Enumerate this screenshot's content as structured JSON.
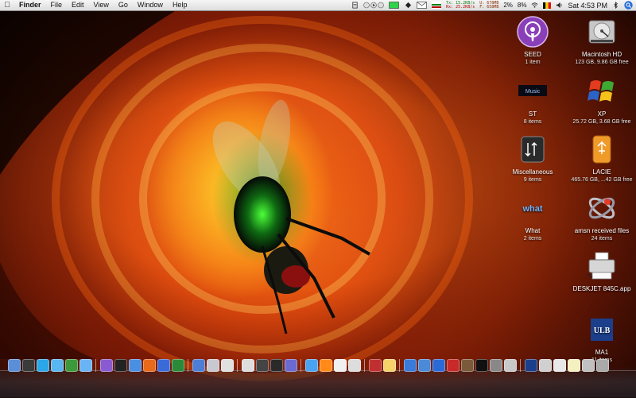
{
  "menubar": {
    "apple_icon": "apple-icon",
    "app_name": "Finder",
    "menus": [
      "File",
      "Edit",
      "View",
      "Go",
      "Window",
      "Help"
    ],
    "network": {
      "tx_label": "Tx:",
      "tx_rate": "15.2KB/s",
      "rx_label": "Rx:",
      "rx_rate": "25.2KB/s",
      "u_label": "U:",
      "u_value": "678MB",
      "f_label": "F:",
      "f_value": "658MB"
    },
    "cpu1": "2%",
    "cpu2": "8%",
    "clock": "Sat 4:53 PM",
    "status_icons": [
      "script-icon",
      "play-controls-icon",
      "battery-meter-icon",
      "growl-icon",
      "mail-icon",
      "bluetooth-icon",
      "wifi-icon",
      "flag-icon",
      "volume-icon",
      "spotlight-icon"
    ]
  },
  "desktop": {
    "icons": [
      {
        "label": "SEED",
        "sub": "1 item",
        "icon": "podcast-icon"
      },
      {
        "label": "Macintosh HD",
        "sub": "123 GB, 9.86 GB free",
        "icon": "hard-drive-icon"
      },
      {
        "label": "ST",
        "sub": "8 items",
        "icon": "music-folder-icon"
      },
      {
        "label": "XP",
        "sub": "25.72 GB, 3.68 GB free",
        "icon": "windows-xp-icon"
      },
      {
        "label": "Miscellaneous",
        "sub": "9 items",
        "icon": "misc-folder-icon"
      },
      {
        "label": "LACIE",
        "sub": "465.76 GB, ...42 GB free",
        "icon": "usb-drive-icon"
      },
      {
        "label": "What",
        "sub": "2 items",
        "icon": "what-folder-icon"
      },
      {
        "label": "amsn received files",
        "sub": "24 items",
        "icon": "amsn-icon"
      },
      {
        "label": "DESKJET 845C.app",
        "sub": "",
        "icon": "printer-icon"
      },
      {
        "label": "MA1",
        "sub": "11 items",
        "icon": "ulb-folder-icon"
      }
    ],
    "ulb_text": "ULB",
    "music_text": "Music",
    "what_text": "what"
  },
  "colors": {
    "menubar": "#e6e6e6",
    "podcast_purple": "#8a3fb8",
    "xp_red": "#e33b1f",
    "xp_green": "#3ea832",
    "xp_blue": "#2b63c7",
    "xp_yellow": "#f4c21a",
    "ulb_navy": "#1b3f8a",
    "lacie_orange": "#f09a2a"
  },
  "dock": {
    "items": [
      "finder-icon",
      "dashboard-icon",
      "skype-icon",
      "chat-icon",
      "android-icon",
      "flask-icon",
      "itunes-icon",
      "dvd-icon",
      "safari-icon",
      "firefox-icon",
      "amsn-dock-icon",
      "globe-icon",
      "preview-icon",
      "mail-dock-icon",
      "calendar-icon",
      "script-editor-icon",
      "pen-icon",
      "calculator-icon",
      "photo-icon",
      "appstore-icon",
      "vlc-icon",
      "pages-icon",
      "ipod-icon",
      "photobooth-icon",
      "notes-icon",
      "xcode-icon",
      "python-icon",
      "safari2-icon",
      "pdf-icon",
      "gallery-icon",
      "terminal-icon",
      "utility-icon",
      "university-icon",
      "ulb-dock-icon",
      "airplane-icon",
      "cloud-icon",
      "lightbulb-icon",
      "bell-icon",
      "trash-icon"
    ]
  }
}
